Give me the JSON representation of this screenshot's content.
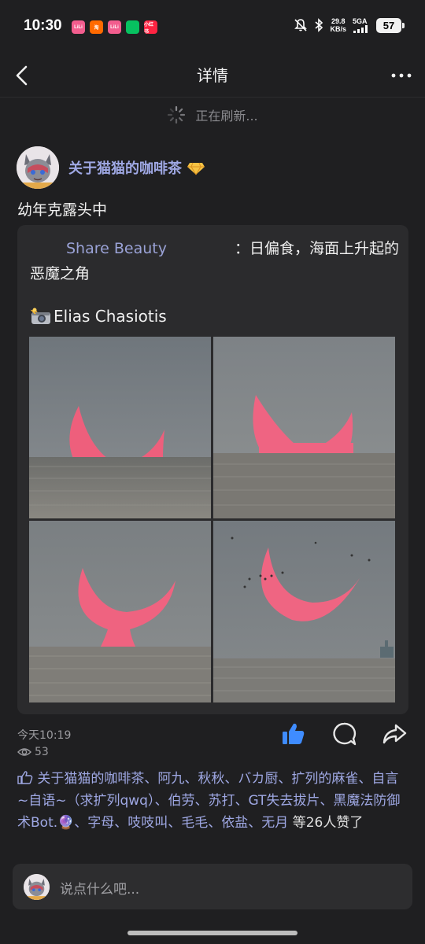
{
  "status_bar": {
    "time": "10:30",
    "apps": [
      {
        "name": "bilibili-app-icon",
        "label": "LiLi",
        "color": "#f25d8e"
      },
      {
        "name": "taobao-app-icon",
        "label": "淘",
        "color": "#ff6a00"
      },
      {
        "name": "bilibili-app-icon-2",
        "label": "LiLi",
        "color": "#f25d8e"
      },
      {
        "name": "wechat-app-icon",
        "label": "",
        "color": "#07c160"
      },
      {
        "name": "xiaohongshu-app-icon",
        "label": "小红书",
        "color": "#ff2442"
      }
    ],
    "speed_value": "29.8",
    "speed_unit": "KB/s",
    "network": "5GA",
    "battery": "57"
  },
  "header": {
    "title": "详情"
  },
  "refresh": {
    "text": "正在刷新..."
  },
  "post": {
    "author": "关于猫猫的咖啡茶",
    "text": "幼年克露头中",
    "share": {
      "link_text": "Share Beauty",
      "description": "：日偏食，海面上升起的恶魔之角",
      "credit": "Elias Chasiotis"
    },
    "time": "今天10:19",
    "views": "53",
    "likes": {
      "names": "关于猫猫的咖啡茶、阿九、秋秋、バカ厨、扩列的麻雀、自言~自语~（求扩列qwq）、伯劳、苏打、GT失去拔片、黑魔法防御术Bot.🔮、字母、吱吱叫、毛毛、依盐、无月",
      "suffix": " 等26人赞了"
    }
  },
  "comment": {
    "placeholder": "说点什么吧..."
  },
  "colors": {
    "background": "#1f1f21",
    "card": "#2b2b2d",
    "accent_blue": "#9fa8e4",
    "like_active": "#3f8cff",
    "sun": "#f06a86"
  }
}
